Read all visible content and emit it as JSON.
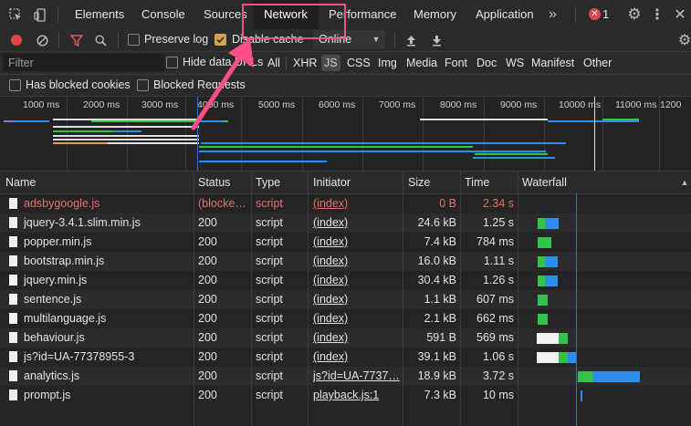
{
  "tabs": {
    "elements": "Elements",
    "console": "Console",
    "sources": "Sources",
    "network": "Network",
    "performance": "Performance",
    "memory": "Memory",
    "application": "Application",
    "more": "»",
    "errors": "1"
  },
  "toolbar": {
    "preserve_log": "Preserve log",
    "disable_cache": "Disable cache",
    "throttling": "Online",
    "preserve_log_checked": false,
    "disable_cache_checked": true
  },
  "filter": {
    "placeholder": "Filter",
    "hide_data_urls": "Hide data URLs",
    "types": [
      "All",
      "XHR",
      "JS",
      "CSS",
      "Img",
      "Media",
      "Font",
      "Doc",
      "WS",
      "Manifest",
      "Other"
    ],
    "selected_type": "JS",
    "has_blocked_cookies": "Has blocked cookies",
    "blocked_requests": "Blocked Requests"
  },
  "overview": {
    "ticks": [
      "1000 ms",
      "2000 ms",
      "3000 ms",
      "4000 ms",
      "5000 ms",
      "6000 ms",
      "7000 ms",
      "8000 ms",
      "9000 ms",
      "10000 ms",
      "11000 ms",
      "1200"
    ]
  },
  "columns": {
    "name": "Name",
    "status": "Status",
    "type": "Type",
    "initiator": "Initiator",
    "size": "Size",
    "time": "Time",
    "waterfall": "Waterfall"
  },
  "requests": [
    {
      "name": "adsbygoogle.js",
      "status": "(blocke…",
      "type": "script",
      "initiator": "(index)",
      "size": "0 B",
      "time": "2.34 s",
      "blocked": true
    },
    {
      "name": "jquery-3.4.1.slim.min.js",
      "status": "200",
      "type": "script",
      "initiator": "(index)",
      "size": "24.6 kB",
      "time": "1.25 s"
    },
    {
      "name": "popper.min.js",
      "status": "200",
      "type": "script",
      "initiator": "(index)",
      "size": "7.4 kB",
      "time": "784 ms"
    },
    {
      "name": "bootstrap.min.js",
      "status": "200",
      "type": "script",
      "initiator": "(index)",
      "size": "16.0 kB",
      "time": "1.11 s"
    },
    {
      "name": "jquery.min.js",
      "status": "200",
      "type": "script",
      "initiator": "(index)",
      "size": "30.4 kB",
      "time": "1.26 s"
    },
    {
      "name": "sentence.js",
      "status": "200",
      "type": "script",
      "initiator": "(index)",
      "size": "1.1 kB",
      "time": "607 ms"
    },
    {
      "name": "multilanguage.js",
      "status": "200",
      "type": "script",
      "initiator": "(index)",
      "size": "2.1 kB",
      "time": "662 ms"
    },
    {
      "name": "behaviour.js",
      "status": "200",
      "type": "script",
      "initiator": "(index)",
      "size": "591 B",
      "time": "569 ms"
    },
    {
      "name": "js?id=UA-77378955-3",
      "status": "200",
      "type": "script",
      "initiator": "(index)",
      "size": "39.1 kB",
      "time": "1.06 s"
    },
    {
      "name": "analytics.js",
      "status": "200",
      "type": "script",
      "initiator": "js?id=UA-7737…",
      "size": "18.9 kB",
      "time": "3.72 s"
    },
    {
      "name": "prompt.js",
      "status": "200",
      "type": "script",
      "initiator": "playback.js:1",
      "size": "7.3 kB",
      "time": "10 ms"
    }
  ],
  "colors": {
    "highlight": "#ff4f8b",
    "wait_green": "#33c24a",
    "download_blue": "#2c8ff0",
    "blocked_red": "#e2726b"
  }
}
